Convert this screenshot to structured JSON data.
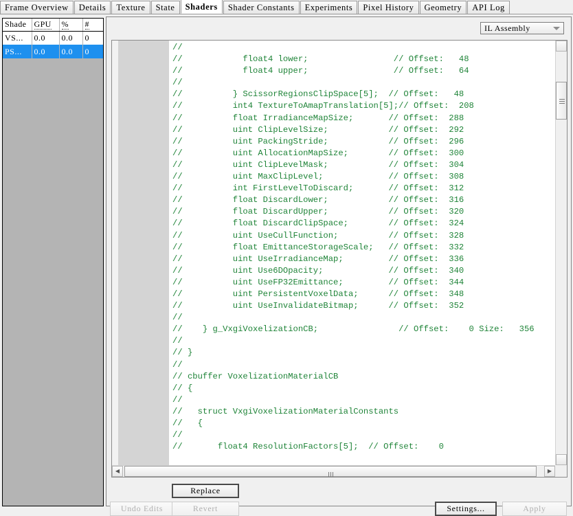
{
  "tabs": [
    {
      "label": "Frame Overview",
      "active": false
    },
    {
      "label": "Details",
      "active": false
    },
    {
      "label": "Texture",
      "active": false
    },
    {
      "label": "State",
      "active": false
    },
    {
      "label": "Shaders",
      "active": true
    },
    {
      "label": "Shader Constants",
      "active": false
    },
    {
      "label": "Experiments",
      "active": false
    },
    {
      "label": "Pixel History",
      "active": false
    },
    {
      "label": "Geometry",
      "active": false
    },
    {
      "label": "API Log",
      "active": false
    }
  ],
  "shader_list": {
    "columns": [
      "Shade",
      "GPU",
      "%",
      "#"
    ],
    "rows": [
      {
        "name": "VS...",
        "gpu": "0.0",
        "pct": "0.0",
        "num": "0",
        "selected": false
      },
      {
        "name": "PS...",
        "gpu": "0.0",
        "pct": "0.0",
        "num": "0",
        "selected": true
      }
    ],
    "selection_color": "#1e90ef"
  },
  "toolbar": {
    "view_mode": "IL Assembly"
  },
  "editor": {
    "text_color": "#1f8438",
    "lines": [
      "//",
      "//            float4 lower;                 // Offset:   48",
      "//            float4 upper;                 // Offset:   64",
      "//",
      "//          } ScissorRegionsClipSpace[5];  // Offset:   48",
      "//          int4 TextureToAmapTranslation[5];// Offset:  208",
      "//          float IrradianceMapSize;       // Offset:  288",
      "//          uint ClipLevelSize;            // Offset:  292",
      "//          uint PackingStride;            // Offset:  296",
      "//          uint AllocationMapSize;        // Offset:  300",
      "//          uint ClipLevelMask;            // Offset:  304",
      "//          uint MaxClipLevel;             // Offset:  308",
      "//          int FirstLevelToDiscard;       // Offset:  312",
      "//          float DiscardLower;            // Offset:  316",
      "//          float DiscardUpper;            // Offset:  320",
      "//          float DiscardClipSpace;        // Offset:  324",
      "//          uint UseCullFunction;          // Offset:  328",
      "//          float EmittanceStorageScale;   // Offset:  332",
      "//          uint UseIrradianceMap;         // Offset:  336",
      "//          uint Use6DOpacity;             // Offset:  340",
      "//          uint UseFP32Emittance;         // Offset:  344",
      "//          uint PersistentVoxelData;      // Offset:  348",
      "//          uint UseInvalidateBitmap;      // Offset:  352",
      "//",
      "//    } g_VxgiVoxelizationCB;                // Offset:    0 Size:   356",
      "//",
      "// }",
      "//",
      "// cbuffer VoxelizationMaterialCB",
      "// {",
      "//",
      "//   struct VxgiVoxelizationMaterialConstants",
      "//   {",
      "//",
      "//       float4 ResolutionFactors[5];  // Offset:    0"
    ]
  },
  "buttons": {
    "replace": "Replace",
    "undo_edits": "Undo Edits",
    "revert": "Revert",
    "settings": "Settings...",
    "apply": "Apply"
  },
  "scroll": {
    "left_arrow": "◀",
    "right_arrow": "▶",
    "up_arrow": "▲",
    "down_arrow": "▼"
  }
}
